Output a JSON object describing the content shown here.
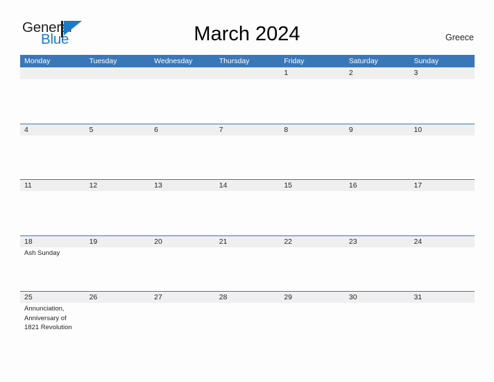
{
  "brand": {
    "name_part1": "General",
    "name_part2": "Blue",
    "flag_icon": "blue-flag-triangle-icon",
    "flag_color": "#1a7bc9"
  },
  "header": {
    "title": "March 2024",
    "region": "Greece"
  },
  "colors": {
    "header_bar": "#3a77b8",
    "week_band": "#efefef",
    "accent_rule": "#3a77b8",
    "page_background": "#fdfdfd",
    "text": "#231f20"
  },
  "calendar": {
    "month": "March",
    "year": "2024",
    "week_start": "Monday",
    "weekdays": [
      "Monday",
      "Tuesday",
      "Wednesday",
      "Thursday",
      "Friday",
      "Saturday",
      "Sunday"
    ],
    "weeks": [
      {
        "days": [
          {
            "num": "",
            "events": []
          },
          {
            "num": "",
            "events": []
          },
          {
            "num": "",
            "events": []
          },
          {
            "num": "",
            "events": []
          },
          {
            "num": "1",
            "events": []
          },
          {
            "num": "2",
            "events": []
          },
          {
            "num": "3",
            "events": []
          }
        ]
      },
      {
        "days": [
          {
            "num": "4",
            "events": []
          },
          {
            "num": "5",
            "events": []
          },
          {
            "num": "6",
            "events": []
          },
          {
            "num": "7",
            "events": []
          },
          {
            "num": "8",
            "events": []
          },
          {
            "num": "9",
            "events": []
          },
          {
            "num": "10",
            "events": []
          }
        ]
      },
      {
        "days": [
          {
            "num": "11",
            "events": []
          },
          {
            "num": "12",
            "events": []
          },
          {
            "num": "13",
            "events": []
          },
          {
            "num": "14",
            "events": []
          },
          {
            "num": "15",
            "events": []
          },
          {
            "num": "16",
            "events": []
          },
          {
            "num": "17",
            "events": []
          }
        ]
      },
      {
        "days": [
          {
            "num": "18",
            "events": [
              "Ash Sunday"
            ]
          },
          {
            "num": "19",
            "events": []
          },
          {
            "num": "20",
            "events": []
          },
          {
            "num": "21",
            "events": []
          },
          {
            "num": "22",
            "events": []
          },
          {
            "num": "23",
            "events": []
          },
          {
            "num": "24",
            "events": []
          }
        ]
      },
      {
        "days": [
          {
            "num": "25",
            "events": [
              "Annunciation, Anniversary of 1821 Revolution"
            ]
          },
          {
            "num": "26",
            "events": []
          },
          {
            "num": "27",
            "events": []
          },
          {
            "num": "28",
            "events": []
          },
          {
            "num": "29",
            "events": []
          },
          {
            "num": "30",
            "events": []
          },
          {
            "num": "31",
            "events": []
          }
        ]
      }
    ]
  }
}
